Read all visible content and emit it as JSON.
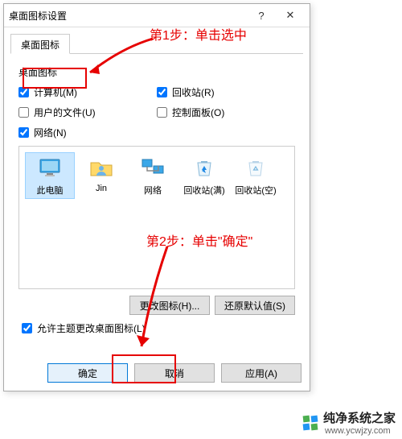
{
  "window": {
    "title": "桌面图标设置",
    "close": "✕",
    "help": "?"
  },
  "tab": {
    "label": "桌面图标"
  },
  "group": {
    "label": "桌面图标"
  },
  "checks": {
    "computer": "计算机(M)",
    "recycle": "回收站(R)",
    "userfiles": "用户的文件(U)",
    "control": "控制面板(O)",
    "network": "网络(N)"
  },
  "icons": {
    "thispc": "此电脑",
    "user": "Jin",
    "network": "网络",
    "recycle_full": "回收站(满)",
    "recycle_empty": "回收站(空)"
  },
  "buttons": {
    "change": "更改图标(H)...",
    "restore": "还原默认值(S)",
    "ok": "确定",
    "cancel": "取消",
    "apply": "应用(A)"
  },
  "allow_theme": "允许主题更改桌面图标(L)",
  "annotations": {
    "step1": "第1步：单击选中",
    "step2": "第2步：单击\"确定\""
  },
  "watermark": {
    "brand": "纯净系统之家",
    "url": "www.ycwjzy.com"
  }
}
